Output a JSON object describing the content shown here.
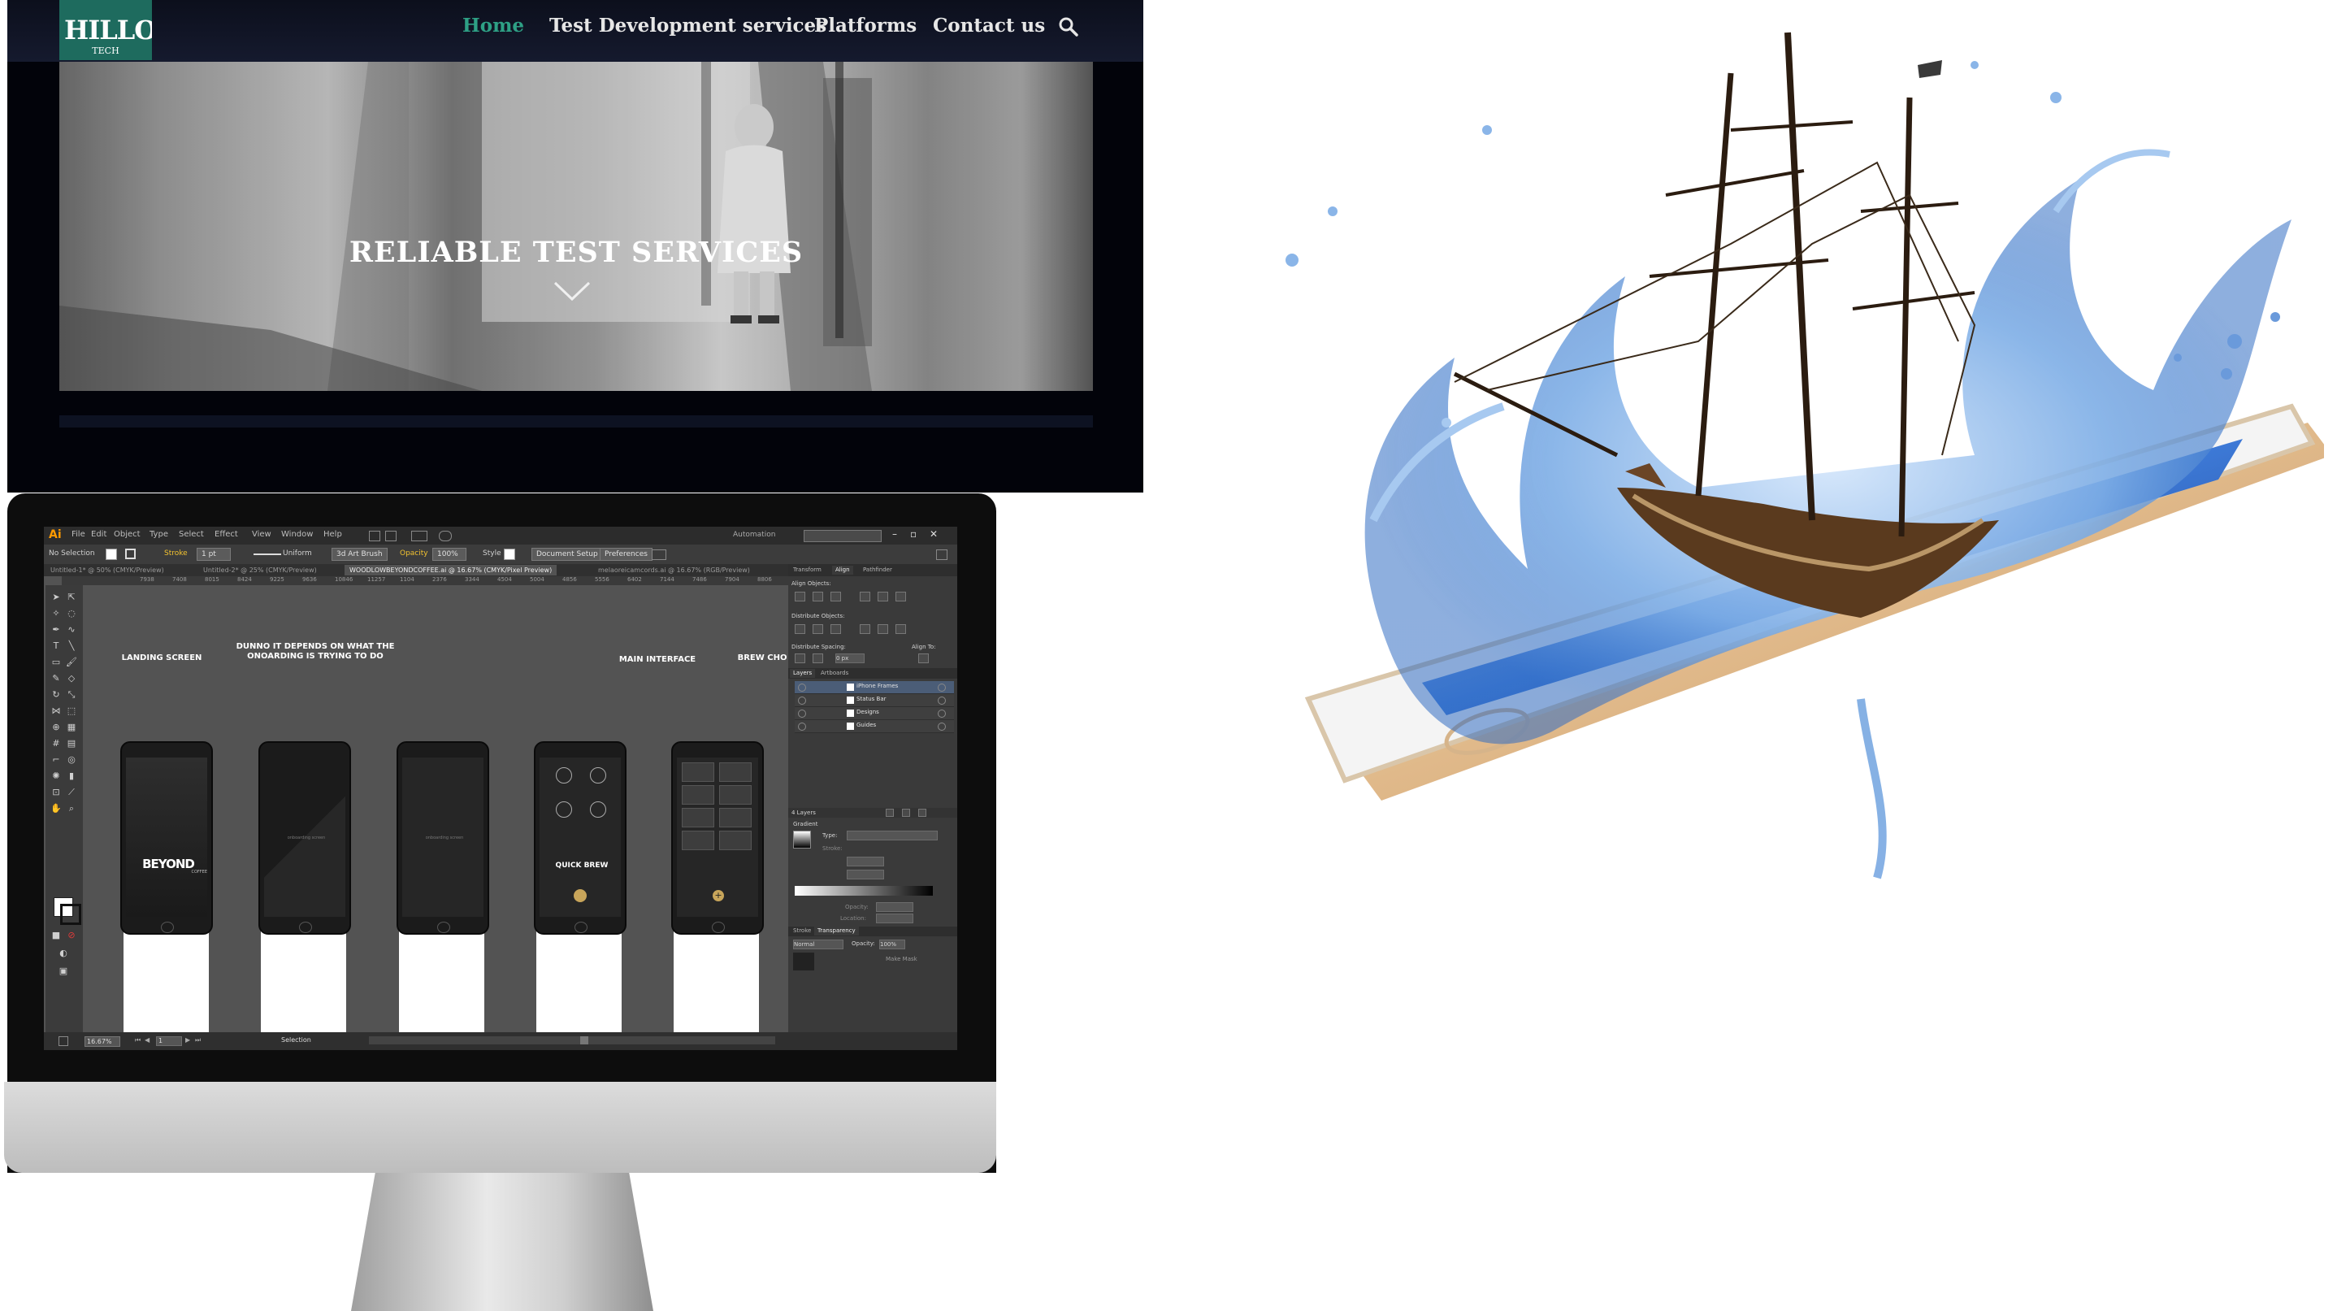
{
  "site": {
    "logo_text": "HILLO",
    "logo_sub": "TECH",
    "nav": {
      "home": "Home",
      "test_dev": "Test Development services",
      "platforms": "Platforms",
      "contact": "Contact us"
    },
    "hero_title": "RELIABLE TEST SERVICES",
    "accent_color": "#2ea085"
  },
  "illustrator": {
    "app_logo": "Ai",
    "menus": [
      "File",
      "Edit",
      "Object",
      "Type",
      "Select",
      "Effect",
      "View",
      "Window",
      "Help"
    ],
    "automation": "Automation",
    "control": {
      "selection": "No Selection",
      "stroke_label": "Stroke",
      "stroke_weight": "1 pt",
      "uniform": "Uniform",
      "brush": "3d Art Brush",
      "opacity_label": "Opacity",
      "opacity_value": "100%",
      "style_label": "Style",
      "document_setup": "Document Setup",
      "preferences": "Preferences"
    },
    "doc_tabs": [
      "Untitled-1* @ 50% (CMYK/Preview)",
      "Untitled-2* @ 25% (CMYK/Preview)",
      "WOODLOWBEYONDCOFFEE.ai @ 16.67% (CMYK/Pixel Preview)",
      "melaoreicamcords.ai @ 16.67% (RGB/Preview)"
    ],
    "ruler_marks": [
      "7938",
      "7408",
      "8015",
      "8424",
      "9225",
      "9636",
      "10846",
      "11257",
      "1104",
      "2376",
      "3344",
      "4504",
      "5004",
      "4856",
      "5556",
      "6402",
      "7144",
      "7486",
      "7904",
      "8806",
      "9476"
    ],
    "artboards": [
      {
        "title": "LANDING SCREEN"
      },
      {
        "title": "DUNNO IT DEPENDS ON WHAT THE ONOARDING IS TRYING TO DO"
      },
      {
        "title": ""
      },
      {
        "title": "MAIN INTERFACE"
      },
      {
        "title": "BREW CHOICE"
      }
    ],
    "phone_texts": {
      "beyond": "BEYOND",
      "coffee": "COFFEE",
      "quick_brew": "QUICK BREW",
      "onboarding_a": "onboarding screen",
      "onboarding_b": "onboarding screen"
    },
    "panels": {
      "top_tabs": [
        "Transform",
        "Align",
        "Pathfinder"
      ],
      "align_objects": "Align Objects:",
      "distribute_objects": "Distribute Objects:",
      "distribute_spacing": "Distribute Spacing:",
      "align_to": "Align To:",
      "spacing_value": "0 px",
      "layer_tabs": [
        "Layers",
        "Artboards"
      ],
      "layers": [
        "iPhone Frames",
        "Status Bar",
        "Designs",
        "Guides"
      ],
      "layers_count": "4 Layers",
      "gradient_title": "Gradient",
      "gradient_type": "Type:",
      "gradient_stroke": "Stroke:",
      "opacity": "Opacity:",
      "location": "Location:",
      "bottom_tabs": [
        "Stroke",
        "Transparency"
      ],
      "blend_mode": "Normal",
      "transp_opacity": "Opacity:",
      "transp_value": "100%",
      "make_mask": "Make Mask"
    },
    "status": {
      "zoom": "16.67%",
      "page": "1",
      "tool": "Selection"
    }
  }
}
